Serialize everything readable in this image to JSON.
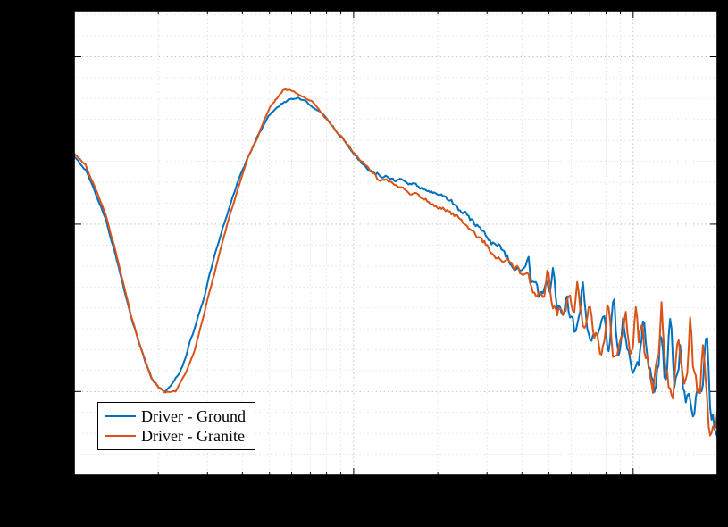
{
  "chart_data": {
    "type": "line",
    "title": "",
    "xlabel": "",
    "ylabel": "",
    "x_scale": "log",
    "xlim": [
      10,
      2000
    ],
    "ylim": [
      -0.05,
      1.06
    ],
    "y_ticks": [
      0.15,
      0.55,
      0.95
    ],
    "legend_position": "lower-left",
    "legend": [
      "Driver - Ground",
      "Driver - Granite"
    ],
    "colors": {
      "ground": "#0072BD",
      "granite": "#D95319",
      "grid_major": "#bcbcbc",
      "grid_minor": "#d2d2d2",
      "axes": "#000000",
      "canvas": "#ffffff"
    },
    "x": [
      10,
      11,
      12,
      13,
      14,
      15,
      16,
      17,
      18,
      19,
      20,
      21,
      22,
      23,
      24,
      25,
      26,
      27,
      28,
      29,
      30,
      32,
      34,
      36,
      38,
      40,
      42,
      44,
      46,
      48,
      50,
      53,
      56,
      60,
      64,
      68,
      72,
      76,
      80,
      85,
      90,
      95,
      100,
      106,
      112,
      118,
      125,
      132,
      140,
      148,
      157,
      166,
      176,
      187,
      198,
      210,
      223,
      236,
      250,
      265,
      281,
      298,
      316,
      335,
      355,
      376,
      398,
      422,
      447,
      474,
      502,
      532,
      563,
      597,
      632,
      670,
      710,
      752,
      797,
      845,
      895,
      949,
      1005,
      1065,
      1129,
      1196,
      1267,
      1343,
      1423,
      1508,
      1598,
      1693,
      1794,
      1901,
      2000
    ],
    "series": [
      {
        "name": "Driver - Ground",
        "color": "#0072BD",
        "values": [
          0.71,
          0.68,
          0.62,
          0.56,
          0.48,
          0.4,
          0.33,
          0.27,
          0.22,
          0.18,
          0.16,
          0.15,
          0.16,
          0.18,
          0.2,
          0.23,
          0.27,
          0.3,
          0.34,
          0.37,
          0.41,
          0.48,
          0.54,
          0.59,
          0.64,
          0.68,
          0.71,
          0.74,
          0.77,
          0.79,
          0.81,
          0.83,
          0.84,
          0.85,
          0.85,
          0.84,
          0.83,
          0.82,
          0.8,
          0.78,
          0.76,
          0.74,
          0.72,
          0.7,
          0.68,
          0.67,
          0.66,
          0.66,
          0.65,
          0.65,
          0.64,
          0.64,
          0.63,
          0.62,
          0.62,
          0.61,
          0.6,
          0.58,
          0.57,
          0.55,
          0.54,
          0.52,
          0.5,
          0.49,
          0.47,
          0.45,
          0.43,
          0.42,
          0.4,
          0.39,
          0.37,
          0.36,
          0.34,
          0.33,
          0.32,
          0.31,
          0.29,
          0.28,
          0.27,
          0.26,
          0.25,
          0.24,
          0.23,
          0.22,
          0.21,
          0.2,
          0.19,
          0.18,
          0.17,
          0.16,
          0.15,
          0.14,
          0.13,
          0.11,
          0.09
        ]
      },
      {
        "name": "Driver - Granite",
        "color": "#D95319",
        "values": [
          0.72,
          0.69,
          0.63,
          0.57,
          0.49,
          0.41,
          0.33,
          0.27,
          0.22,
          0.18,
          0.16,
          0.15,
          0.15,
          0.15,
          0.17,
          0.19,
          0.22,
          0.25,
          0.29,
          0.33,
          0.37,
          0.44,
          0.51,
          0.57,
          0.62,
          0.67,
          0.71,
          0.74,
          0.77,
          0.8,
          0.83,
          0.85,
          0.87,
          0.87,
          0.86,
          0.85,
          0.84,
          0.82,
          0.8,
          0.78,
          0.76,
          0.74,
          0.72,
          0.7,
          0.69,
          0.67,
          0.66,
          0.66,
          0.65,
          0.64,
          0.63,
          0.63,
          0.62,
          0.61,
          0.6,
          0.59,
          0.58,
          0.57,
          0.55,
          0.54,
          0.52,
          0.51,
          0.49,
          0.48,
          0.46,
          0.45,
          0.43,
          0.41,
          0.4,
          0.38,
          0.37,
          0.36,
          0.34,
          0.33,
          0.32,
          0.31,
          0.3,
          0.29,
          0.28,
          0.27,
          0.26,
          0.25,
          0.24,
          0.23,
          0.22,
          0.21,
          0.2,
          0.19,
          0.18,
          0.17,
          0.16,
          0.15,
          0.14,
          0.12,
          0.1
        ]
      }
    ]
  }
}
